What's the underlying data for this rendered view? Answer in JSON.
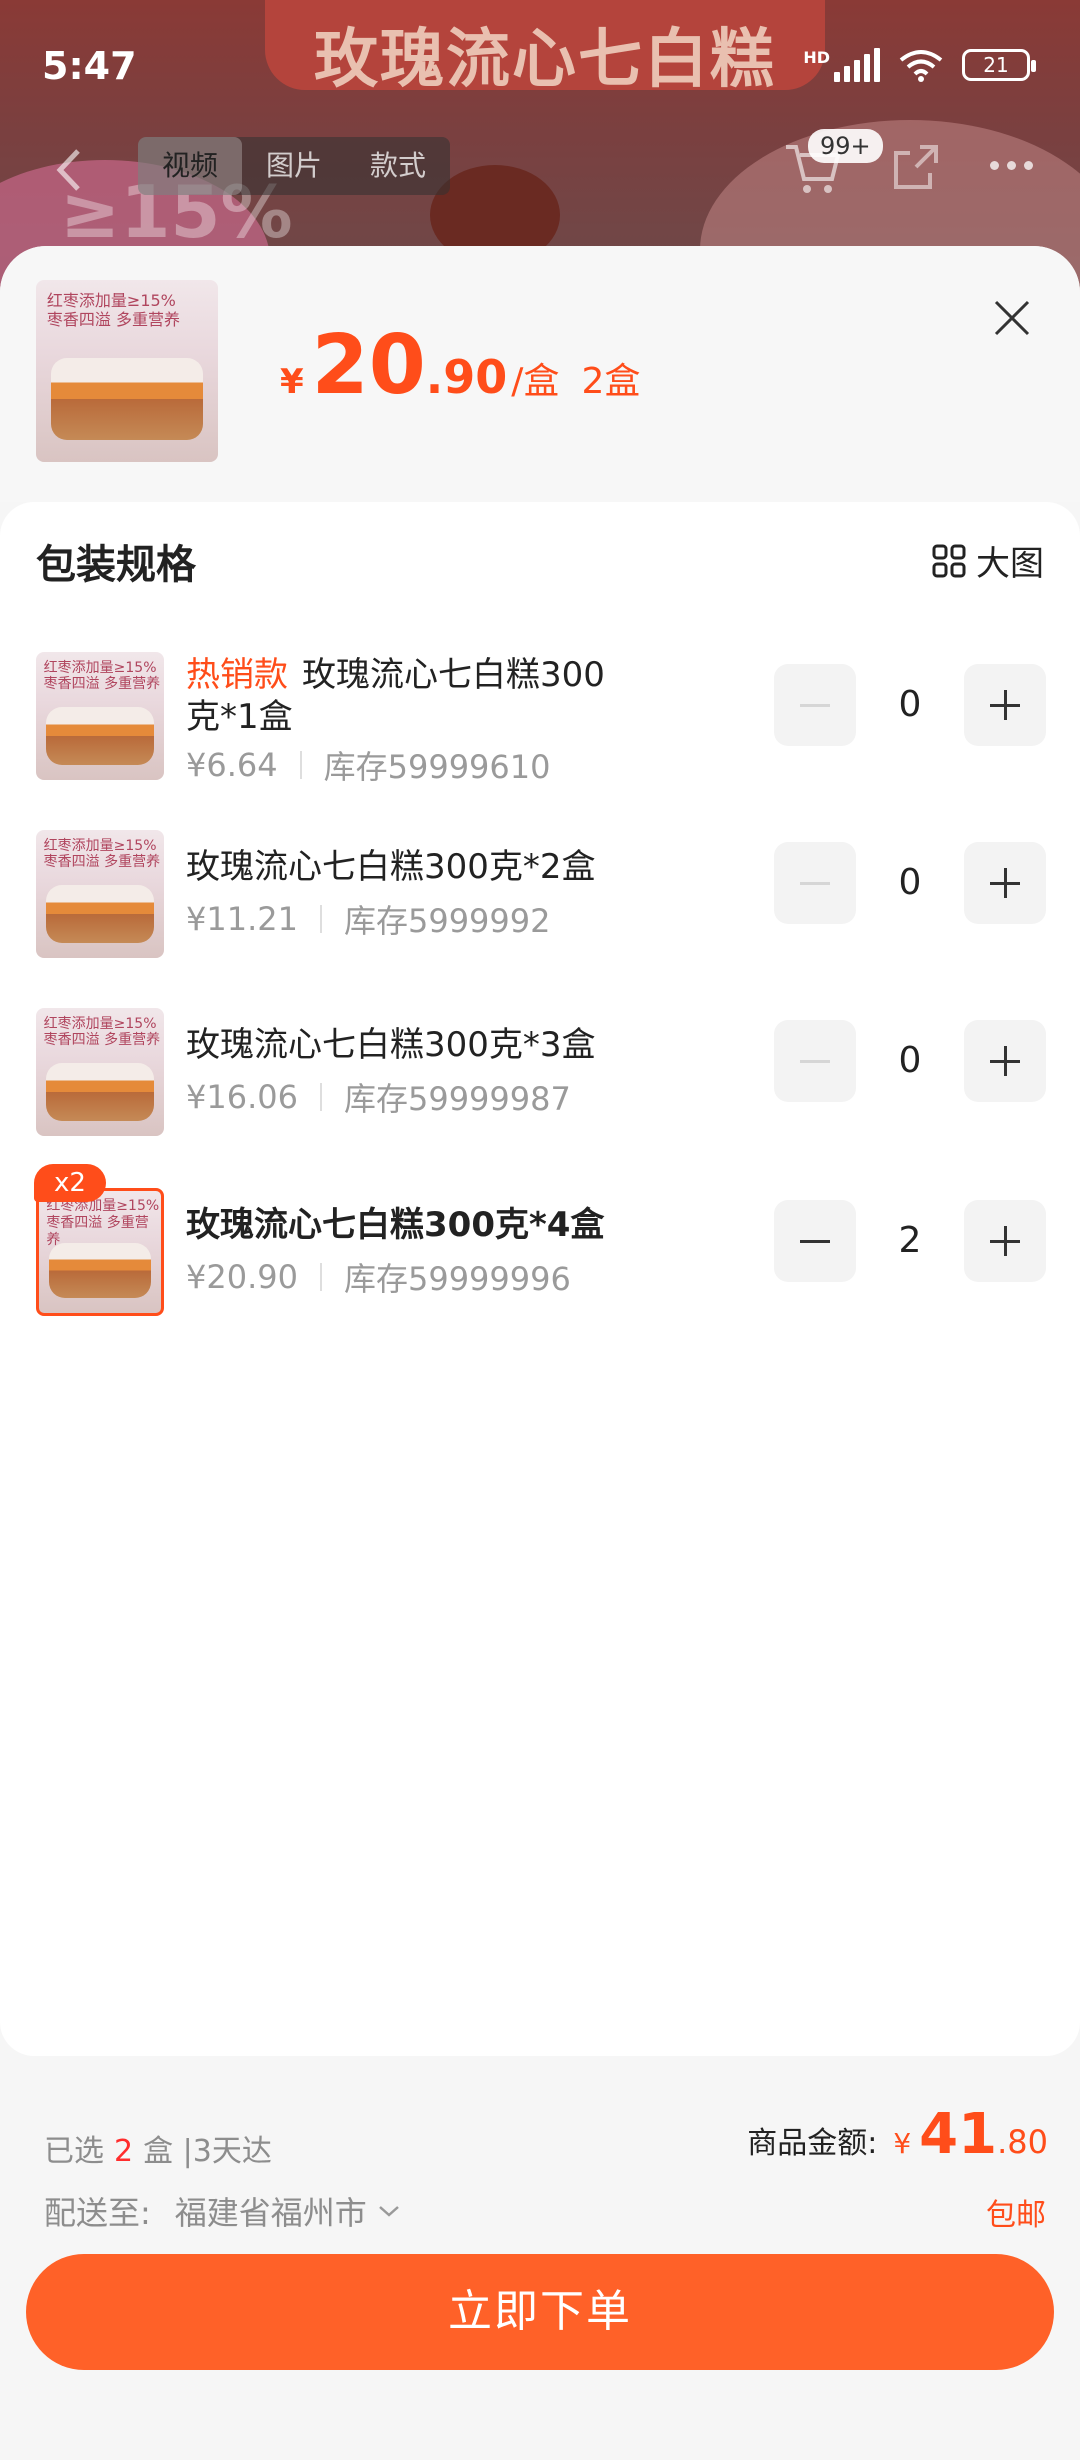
{
  "status_bar": {
    "time": "5:47",
    "network": "HD",
    "battery": "21"
  },
  "background": {
    "banner_title": "玫瑰流心七白糕",
    "promo_text": "≥15%"
  },
  "nav": {
    "media_tabs": [
      {
        "label": "视频",
        "active": true
      },
      {
        "label": "图片",
        "active": false
      },
      {
        "label": "款式",
        "active": false
      }
    ],
    "cart_badge": "99+"
  },
  "sheet": {
    "thumb_text_line1": "红枣添加量≥15%",
    "thumb_text_line2": "枣香四溢 多重营养",
    "price": {
      "symbol": "¥",
      "integer": "20",
      "decimal": ".90",
      "unit": "/盒",
      "quantity": "2盒"
    },
    "spec_title": "包装规格",
    "big_picture_label": "大图",
    "items": [
      {
        "tag": "热销款",
        "name": "玫瑰流心七白糕300克*1盒",
        "price": "¥6.64",
        "stock": "库存59999610",
        "quantity": "0",
        "selected": false
      },
      {
        "tag": "",
        "name": "玫瑰流心七白糕300克*2盒",
        "price": "¥11.21",
        "stock": "库存5999992",
        "quantity": "0",
        "selected": false
      },
      {
        "tag": "",
        "name": "玫瑰流心七白糕300克*3盒",
        "price": "¥16.06",
        "stock": "库存59999987",
        "quantity": "0",
        "selected": false
      },
      {
        "tag": "",
        "name": "玫瑰流心七白糕300克*4盒",
        "price": "¥20.90",
        "stock": "库存59999996",
        "quantity": "2",
        "selected": true,
        "badge": "x2"
      }
    ]
  },
  "footer": {
    "selected_prefix": "已选",
    "selected_count": "2",
    "selected_suffix": "盒 |3天达",
    "total_label": "商品金额:",
    "total_symbol": "¥",
    "total_integer": "41",
    "total_decimal": ".80",
    "ship_label": "配送至:",
    "ship_address": "福建省福州市",
    "free_shipping": "包邮",
    "order_button": "立即下单"
  },
  "colors": {
    "accent": "#ff4d1a",
    "order_button": "#ff6128"
  }
}
